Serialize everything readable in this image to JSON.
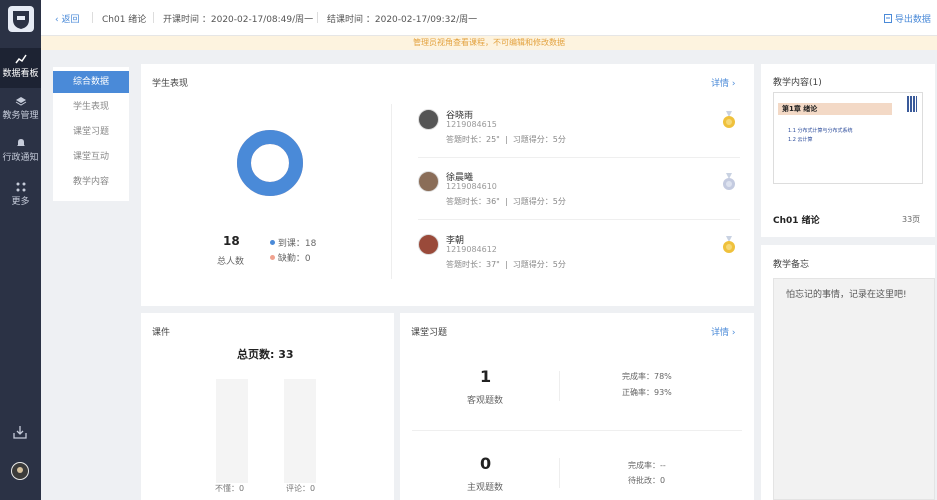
{
  "sidebar": {
    "items": [
      {
        "label": "数据看板",
        "icon": "chart-icon"
      },
      {
        "label": "教务管理",
        "icon": "layers-icon"
      },
      {
        "label": "行政通知",
        "icon": "bell-icon"
      },
      {
        "label": "更多",
        "icon": "grid-icon"
      }
    ]
  },
  "header": {
    "back_label": "返回",
    "course": "Ch01 绪论",
    "start_time": "开课时间 ：2020-02-17/08:49/周一",
    "end_time": "结课时间 ：2020-02-17/09:32/周一",
    "export_label": "导出数据"
  },
  "notice": "管理员视角查看课程，不可编辑和修改数据",
  "submenu": {
    "items": [
      "综合数据",
      "学生表现",
      "课堂习题",
      "课堂互动",
      "教学内容"
    ],
    "active_index": 0
  },
  "performance": {
    "title": "学生表现",
    "detail": "详情",
    "total_count": "18",
    "total_label": "总人数",
    "attend": "到课：18",
    "absent": "缺勤：0",
    "attendance_rate": 1.0,
    "colors": {
      "attend": "#4a8ad8",
      "absent": "#f0a28f"
    },
    "students": [
      {
        "name": "谷晓雨",
        "id": "1219084615",
        "duration": "答题时长：25\"",
        "score": "习题得分：5分",
        "medal": "gold"
      },
      {
        "name": "徐晨曦",
        "id": "1219084610",
        "duration": "答题时长：36\"",
        "score": "习题得分：5分",
        "medal": "silver"
      },
      {
        "name": "李朝",
        "id": "1219084612",
        "duration": "答题时长：37\"",
        "score": "习题得分：5分",
        "medal": "gold"
      }
    ]
  },
  "courseware": {
    "title": "课件",
    "total_pages": "总页数: 33",
    "not_understand": "不懂：0",
    "comments": "评论：0"
  },
  "exercise": {
    "title": "课堂习题",
    "detail": "详情",
    "objective_count": "1",
    "objective_label": "客观题数",
    "completion": "完成率：78%",
    "accuracy": "正确率：93%",
    "subjective_count": "0",
    "subjective_label": "主观题数",
    "sub_completion": "完成率：--",
    "pending": "待批改：0"
  },
  "content": {
    "title": "教学内容(1)",
    "slide_heading": "第1章 绪论",
    "slide_line1": "1.1 分布式计算与分布式系统",
    "slide_line2": "1.2 云计算",
    "name": "Ch01 绪论",
    "pages": "33页"
  },
  "memo": {
    "title": "教学备忘",
    "placeholder": "怕忘记的事情，记录在这里吧!"
  },
  "colors": {
    "accent": "#4a8ad8",
    "sidebar": "#2b3245",
    "notice_bg": "#fdf3df",
    "notice_text": "#e3a23f"
  }
}
